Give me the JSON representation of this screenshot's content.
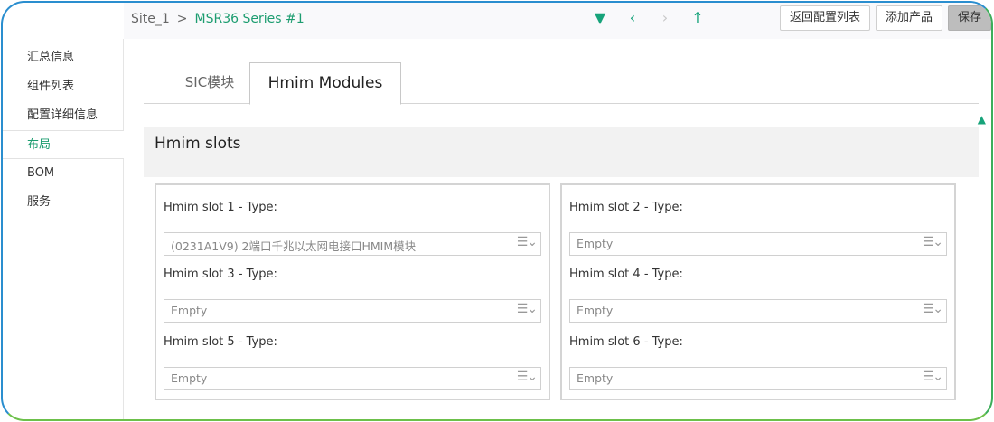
{
  "breadcrumb": {
    "site": "Site_1",
    "separator": ">",
    "current": "MSR36 Series #1"
  },
  "nav_icons": [
    "filter-down-icon",
    "chevron-left-icon",
    "chevron-right-icon",
    "arrow-up-icon"
  ],
  "toolbar": {
    "back_label": "返回配置列表",
    "add_label": "添加产品",
    "save_label": "保存"
  },
  "sidebar": {
    "items": [
      {
        "label": "汇总信息",
        "active": false
      },
      {
        "label": "组件列表",
        "active": false
      },
      {
        "label": "配置详细信息",
        "active": false
      },
      {
        "label": "布局",
        "active": true
      },
      {
        "label": "BOM",
        "active": false
      },
      {
        "label": "服务",
        "active": false
      }
    ]
  },
  "tabs": [
    {
      "label": "SIC模块",
      "active": false
    },
    {
      "label": "Hmim Modules",
      "active": true
    }
  ],
  "section": {
    "title": "Hmim slots"
  },
  "slots": [
    {
      "label": "Hmim slot 1 - Type:",
      "value": "(0231A1V9) 2端口千兆以太网电接口HMIM模块"
    },
    {
      "label": "Hmim slot 2 - Type:",
      "value": "Empty"
    },
    {
      "label": "Hmim slot 3 - Type:",
      "value": "Empty"
    },
    {
      "label": "Hmim slot 4 - Type:",
      "value": "Empty"
    },
    {
      "label": "Hmim slot 5 - Type:",
      "value": "Empty"
    },
    {
      "label": "Hmim slot 6 - Type:",
      "value": "Empty"
    }
  ],
  "colors": {
    "accent": "#1d9d70",
    "frame_blue": "#2a8ecf",
    "frame_green": "#6cc04a"
  }
}
